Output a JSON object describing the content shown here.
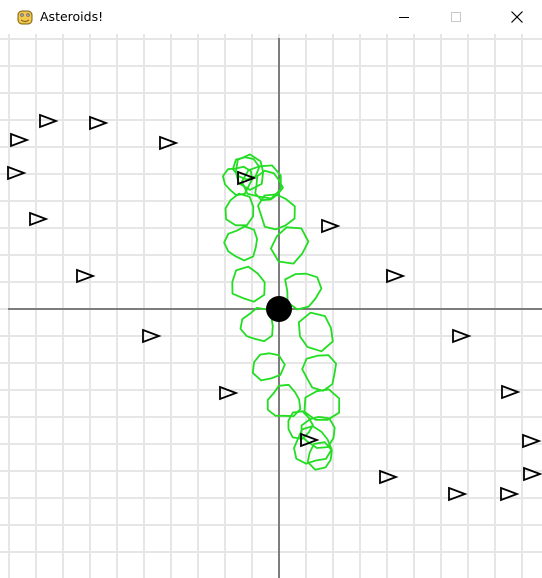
{
  "window": {
    "title": "Asteroids!",
    "icon": "pygame-snake-icon",
    "controls": {
      "minimize_icon": "minimize-icon",
      "maximize_icon": "maximize-icon",
      "close_icon": "close-icon"
    }
  },
  "game": {
    "background_color": "#ffffff",
    "grid_color": "#e6e6e6",
    "axis_color": "#5a5a5a",
    "asteroid_color": "#22dd22",
    "ship_color": "#000000",
    "player_color": "#000000"
  }
}
